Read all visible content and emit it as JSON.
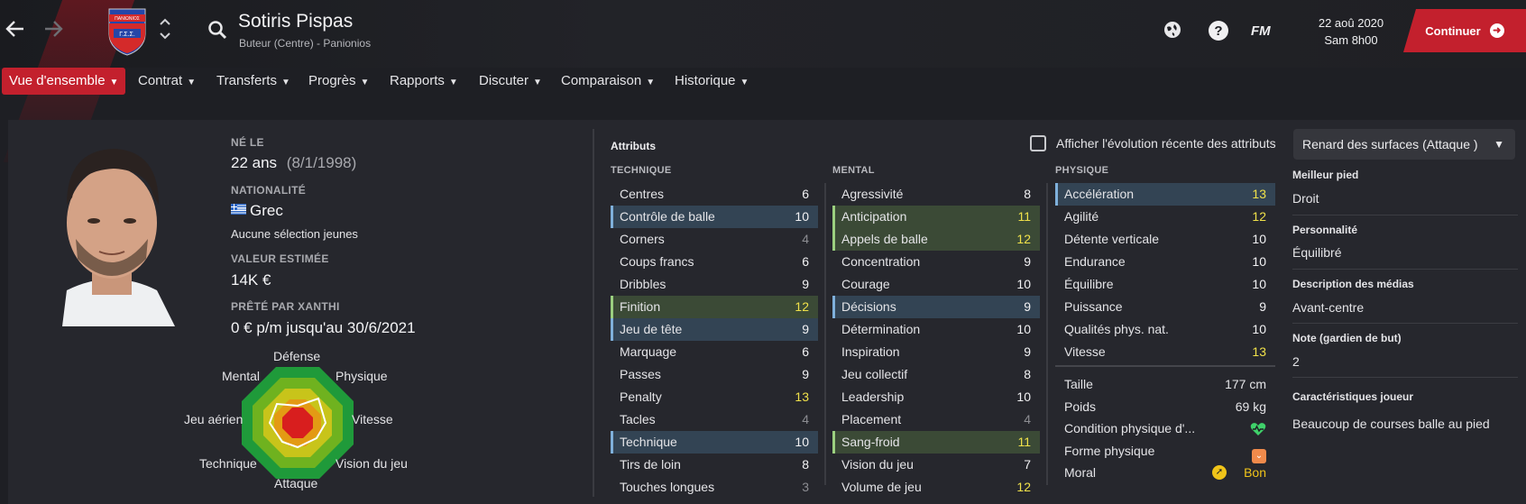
{
  "header": {
    "player_name": "Sotiris Pispas",
    "subtitle": "Buteur (Centre) - Panionios",
    "date_line1": "22 aoû 2020",
    "date_line2": "Sam 8h00",
    "continue_label": "Continuer",
    "icons": [
      "back-arrow-icon",
      "forward-arrow-icon",
      "club-crest-icon",
      "up-down-chevron-icon",
      "search-icon",
      "world-icon",
      "help-icon",
      "fm-logo-icon",
      "continue-arrow-icon"
    ]
  },
  "menu": {
    "items": [
      {
        "label": "Vue d'ensemble",
        "active": true
      },
      {
        "label": "Contrat"
      },
      {
        "label": "Transferts"
      },
      {
        "label": "Progrès"
      },
      {
        "label": "Rapports"
      },
      {
        "label": "Discuter"
      },
      {
        "label": "Comparaison"
      },
      {
        "label": "Historique"
      }
    ]
  },
  "profile": {
    "born_label": "NÉ LE",
    "age": "22 ans",
    "dob": "(8/1/1998)",
    "nationality_label": "NATIONALITÉ",
    "nationality": "Grec",
    "youth_caps": "Aucune sélection jeunes",
    "value_label": "VALEUR ESTIMÉE",
    "value": "14K €",
    "loan_label": "PRÊTÉ PAR XANTHI",
    "loan_value": "0 € p/m jusqu'au 30/6/2021"
  },
  "radar": {
    "labels": {
      "top": "Défense",
      "top_right": "Physique",
      "right": "Vitesse",
      "bottom_right": "Vision du jeu",
      "bottom": "Attaque",
      "bottom_left": "Technique",
      "left": "Jeu aérien",
      "top_left": "Mental"
    }
  },
  "attributes": {
    "title": "Attributs",
    "show_recent_label": "Afficher l'évolution récente des attributs",
    "role": "Renard des surfaces (Attaque )",
    "technique_header": "TECHNIQUE",
    "mental_header": "MENTAL",
    "physique_header": "PHYSIQUE",
    "colors": {
      "highlight_blue": "#334454",
      "highlight_green": "#3b4a36",
      "yellow": "#f0e14a",
      "gray": "#8c8d92"
    },
    "technique": [
      {
        "name": "Centres",
        "value": "6",
        "hl": "",
        "c": "white"
      },
      {
        "name": "Contrôle de balle",
        "value": "10",
        "hl": "blue",
        "c": "white"
      },
      {
        "name": "Corners",
        "value": "4",
        "hl": "",
        "c": "gray"
      },
      {
        "name": "Coups francs",
        "value": "6",
        "hl": "",
        "c": "white"
      },
      {
        "name": "Dribbles",
        "value": "9",
        "hl": "",
        "c": "white"
      },
      {
        "name": "Finition",
        "value": "12",
        "hl": "green",
        "c": "yellow"
      },
      {
        "name": "Jeu de tête",
        "value": "9",
        "hl": "blue",
        "c": "white"
      },
      {
        "name": "Marquage",
        "value": "6",
        "hl": "",
        "c": "white"
      },
      {
        "name": "Passes",
        "value": "9",
        "hl": "",
        "c": "white"
      },
      {
        "name": "Penalty",
        "value": "13",
        "hl": "",
        "c": "yellow"
      },
      {
        "name": "Tacles",
        "value": "4",
        "hl": "",
        "c": "gray"
      },
      {
        "name": "Technique",
        "value": "10",
        "hl": "blue",
        "c": "white"
      },
      {
        "name": "Tirs de loin",
        "value": "8",
        "hl": "",
        "c": "white"
      },
      {
        "name": "Touches longues",
        "value": "3",
        "hl": "",
        "c": "gray"
      }
    ],
    "mental": [
      {
        "name": "Agressivité",
        "value": "8",
        "hl": "",
        "c": "white"
      },
      {
        "name": "Anticipation",
        "value": "11",
        "hl": "green",
        "c": "yellow"
      },
      {
        "name": "Appels de balle",
        "value": "12",
        "hl": "green",
        "c": "yellow"
      },
      {
        "name": "Concentration",
        "value": "9",
        "hl": "",
        "c": "white"
      },
      {
        "name": "Courage",
        "value": "10",
        "hl": "",
        "c": "white"
      },
      {
        "name": "Décisions",
        "value": "9",
        "hl": "blue",
        "c": "white"
      },
      {
        "name": "Détermination",
        "value": "10",
        "hl": "",
        "c": "white"
      },
      {
        "name": "Inspiration",
        "value": "9",
        "hl": "",
        "c": "white"
      },
      {
        "name": "Jeu collectif",
        "value": "8",
        "hl": "",
        "c": "white"
      },
      {
        "name": "Leadership",
        "value": "10",
        "hl": "",
        "c": "white"
      },
      {
        "name": "Placement",
        "value": "4",
        "hl": "",
        "c": "gray"
      },
      {
        "name": "Sang-froid",
        "value": "11",
        "hl": "green",
        "c": "yellow"
      },
      {
        "name": "Vision du jeu",
        "value": "7",
        "hl": "",
        "c": "white"
      },
      {
        "name": "Volume de jeu",
        "value": "12",
        "hl": "",
        "c": "yellow"
      }
    ],
    "physique": [
      {
        "name": "Accélération",
        "value": "13",
        "hl": "blue",
        "c": "yellow"
      },
      {
        "name": "Agilité",
        "value": "12",
        "hl": "",
        "c": "yellow"
      },
      {
        "name": "Détente verticale",
        "value": "10",
        "hl": "",
        "c": "white"
      },
      {
        "name": "Endurance",
        "value": "10",
        "hl": "",
        "c": "white"
      },
      {
        "name": "Équilibre",
        "value": "10",
        "hl": "",
        "c": "white"
      },
      {
        "name": "Puissance",
        "value": "9",
        "hl": "",
        "c": "white"
      },
      {
        "name": "Qualités phys. nat.",
        "value": "10",
        "hl": "",
        "c": "white"
      },
      {
        "name": "Vitesse",
        "value": "13",
        "hl": "",
        "c": "yellow"
      }
    ],
    "body": [
      {
        "name": "Taille",
        "value": "177 cm"
      },
      {
        "name": "Poids",
        "value": "69 kg"
      },
      {
        "name": "Condition physique d'...",
        "icon": "heart-icon"
      },
      {
        "name": "Forme physique",
        "icon": "form-down-icon"
      },
      {
        "name": "Moral",
        "value": "Bon",
        "icon": "morale-icon"
      }
    ]
  },
  "info": {
    "best_foot_label": "Meilleur pied",
    "best_foot": "Droit",
    "personality_label": "Personnalité",
    "personality": "Équilibré",
    "media_label": "Description des médias",
    "media": "Avant-centre",
    "gk_label": "Note (gardien de but)",
    "gk": "2",
    "traits_label": "Caractéristiques joueur",
    "traits": "Beaucoup de courses balle au pied"
  }
}
